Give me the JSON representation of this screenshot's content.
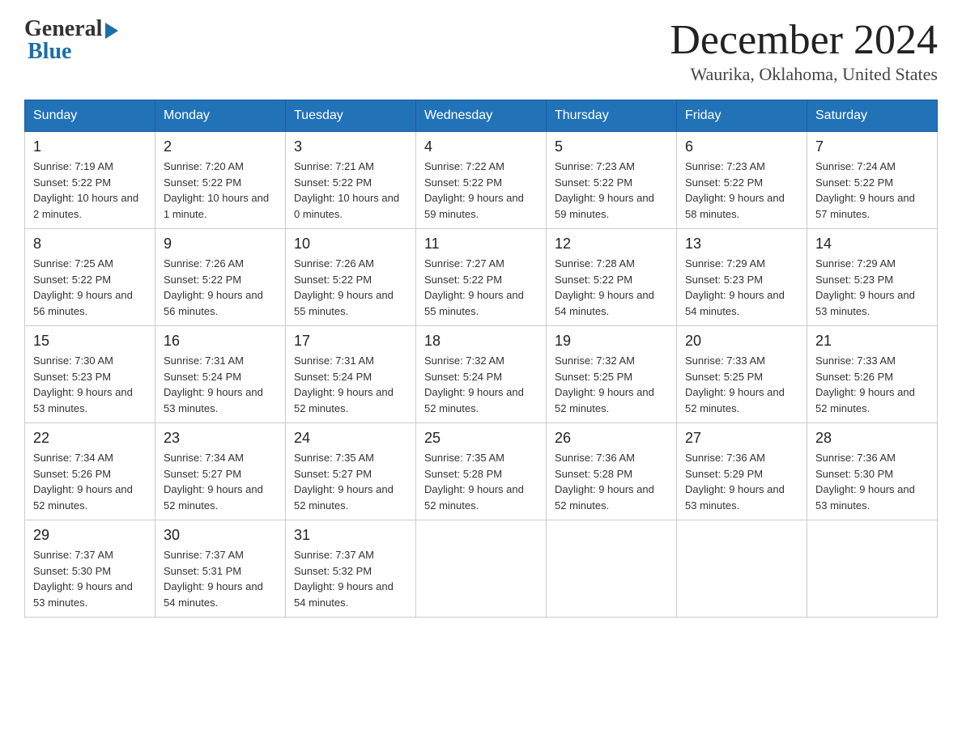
{
  "logo": {
    "general": "General",
    "blue": "Blue"
  },
  "title": "December 2024",
  "subtitle": "Waurika, Oklahoma, United States",
  "weekdays": [
    "Sunday",
    "Monday",
    "Tuesday",
    "Wednesday",
    "Thursday",
    "Friday",
    "Saturday"
  ],
  "weeks": [
    [
      {
        "day": "1",
        "sunrise": "7:19 AM",
        "sunset": "5:22 PM",
        "daylight": "10 hours and 2 minutes."
      },
      {
        "day": "2",
        "sunrise": "7:20 AM",
        "sunset": "5:22 PM",
        "daylight": "10 hours and 1 minute."
      },
      {
        "day": "3",
        "sunrise": "7:21 AM",
        "sunset": "5:22 PM",
        "daylight": "10 hours and 0 minutes."
      },
      {
        "day": "4",
        "sunrise": "7:22 AM",
        "sunset": "5:22 PM",
        "daylight": "9 hours and 59 minutes."
      },
      {
        "day": "5",
        "sunrise": "7:23 AM",
        "sunset": "5:22 PM",
        "daylight": "9 hours and 59 minutes."
      },
      {
        "day": "6",
        "sunrise": "7:23 AM",
        "sunset": "5:22 PM",
        "daylight": "9 hours and 58 minutes."
      },
      {
        "day": "7",
        "sunrise": "7:24 AM",
        "sunset": "5:22 PM",
        "daylight": "9 hours and 57 minutes."
      }
    ],
    [
      {
        "day": "8",
        "sunrise": "7:25 AM",
        "sunset": "5:22 PM",
        "daylight": "9 hours and 56 minutes."
      },
      {
        "day": "9",
        "sunrise": "7:26 AM",
        "sunset": "5:22 PM",
        "daylight": "9 hours and 56 minutes."
      },
      {
        "day": "10",
        "sunrise": "7:26 AM",
        "sunset": "5:22 PM",
        "daylight": "9 hours and 55 minutes."
      },
      {
        "day": "11",
        "sunrise": "7:27 AM",
        "sunset": "5:22 PM",
        "daylight": "9 hours and 55 minutes."
      },
      {
        "day": "12",
        "sunrise": "7:28 AM",
        "sunset": "5:22 PM",
        "daylight": "9 hours and 54 minutes."
      },
      {
        "day": "13",
        "sunrise": "7:29 AM",
        "sunset": "5:23 PM",
        "daylight": "9 hours and 54 minutes."
      },
      {
        "day": "14",
        "sunrise": "7:29 AM",
        "sunset": "5:23 PM",
        "daylight": "9 hours and 53 minutes."
      }
    ],
    [
      {
        "day": "15",
        "sunrise": "7:30 AM",
        "sunset": "5:23 PM",
        "daylight": "9 hours and 53 minutes."
      },
      {
        "day": "16",
        "sunrise": "7:31 AM",
        "sunset": "5:24 PM",
        "daylight": "9 hours and 53 minutes."
      },
      {
        "day": "17",
        "sunrise": "7:31 AM",
        "sunset": "5:24 PM",
        "daylight": "9 hours and 52 minutes."
      },
      {
        "day": "18",
        "sunrise": "7:32 AM",
        "sunset": "5:24 PM",
        "daylight": "9 hours and 52 minutes."
      },
      {
        "day": "19",
        "sunrise": "7:32 AM",
        "sunset": "5:25 PM",
        "daylight": "9 hours and 52 minutes."
      },
      {
        "day": "20",
        "sunrise": "7:33 AM",
        "sunset": "5:25 PM",
        "daylight": "9 hours and 52 minutes."
      },
      {
        "day": "21",
        "sunrise": "7:33 AM",
        "sunset": "5:26 PM",
        "daylight": "9 hours and 52 minutes."
      }
    ],
    [
      {
        "day": "22",
        "sunrise": "7:34 AM",
        "sunset": "5:26 PM",
        "daylight": "9 hours and 52 minutes."
      },
      {
        "day": "23",
        "sunrise": "7:34 AM",
        "sunset": "5:27 PM",
        "daylight": "9 hours and 52 minutes."
      },
      {
        "day": "24",
        "sunrise": "7:35 AM",
        "sunset": "5:27 PM",
        "daylight": "9 hours and 52 minutes."
      },
      {
        "day": "25",
        "sunrise": "7:35 AM",
        "sunset": "5:28 PM",
        "daylight": "9 hours and 52 minutes."
      },
      {
        "day": "26",
        "sunrise": "7:36 AM",
        "sunset": "5:28 PM",
        "daylight": "9 hours and 52 minutes."
      },
      {
        "day": "27",
        "sunrise": "7:36 AM",
        "sunset": "5:29 PM",
        "daylight": "9 hours and 53 minutes."
      },
      {
        "day": "28",
        "sunrise": "7:36 AM",
        "sunset": "5:30 PM",
        "daylight": "9 hours and 53 minutes."
      }
    ],
    [
      {
        "day": "29",
        "sunrise": "7:37 AM",
        "sunset": "5:30 PM",
        "daylight": "9 hours and 53 minutes."
      },
      {
        "day": "30",
        "sunrise": "7:37 AM",
        "sunset": "5:31 PM",
        "daylight": "9 hours and 54 minutes."
      },
      {
        "day": "31",
        "sunrise": "7:37 AM",
        "sunset": "5:32 PM",
        "daylight": "9 hours and 54 minutes."
      },
      null,
      null,
      null,
      null
    ]
  ]
}
